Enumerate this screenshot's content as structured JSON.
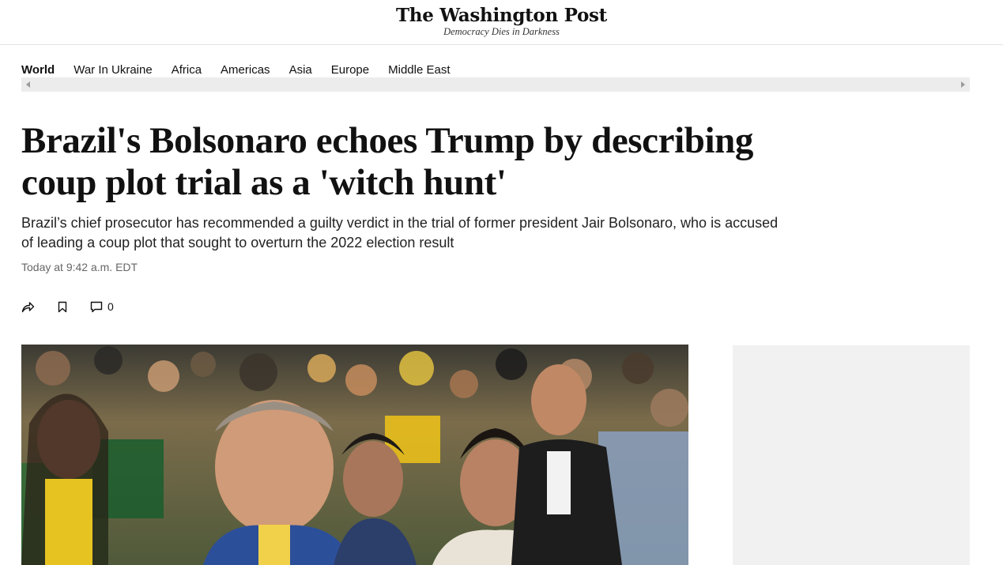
{
  "masthead": {
    "logo_text": "The Washington Post",
    "tagline": "Democracy Dies in Darkness"
  },
  "section_nav": {
    "items": [
      {
        "label": "World",
        "active": true
      },
      {
        "label": "War In Ukraine",
        "active": false
      },
      {
        "label": "Africa",
        "active": false
      },
      {
        "label": "Americas",
        "active": false
      },
      {
        "label": "Asia",
        "active": false
      },
      {
        "label": "Europe",
        "active": false
      },
      {
        "label": "Middle East",
        "active": false
      }
    ]
  },
  "article": {
    "headline": "Brazil's Bolsonaro echoes Trump by describing coup plot trial as a 'witch hunt'",
    "dek": "Brazil’s chief prosecutor has recommended a guilty verdict in the trial of former president Jair Bolsonaro, who is accused of leading a coup plot that sought to overturn the 2022 election result",
    "timestamp": "Today at 9:42 a.m. EDT",
    "actions": {
      "share_icon": "share-icon",
      "bookmark_icon": "bookmark-icon",
      "comment_icon": "comment-icon",
      "comment_count": "0"
    }
  },
  "colors": {
    "text": "#111111",
    "muted": "#666666",
    "ad_background": "#f1f1f1",
    "scrollbar": "#ececec"
  }
}
